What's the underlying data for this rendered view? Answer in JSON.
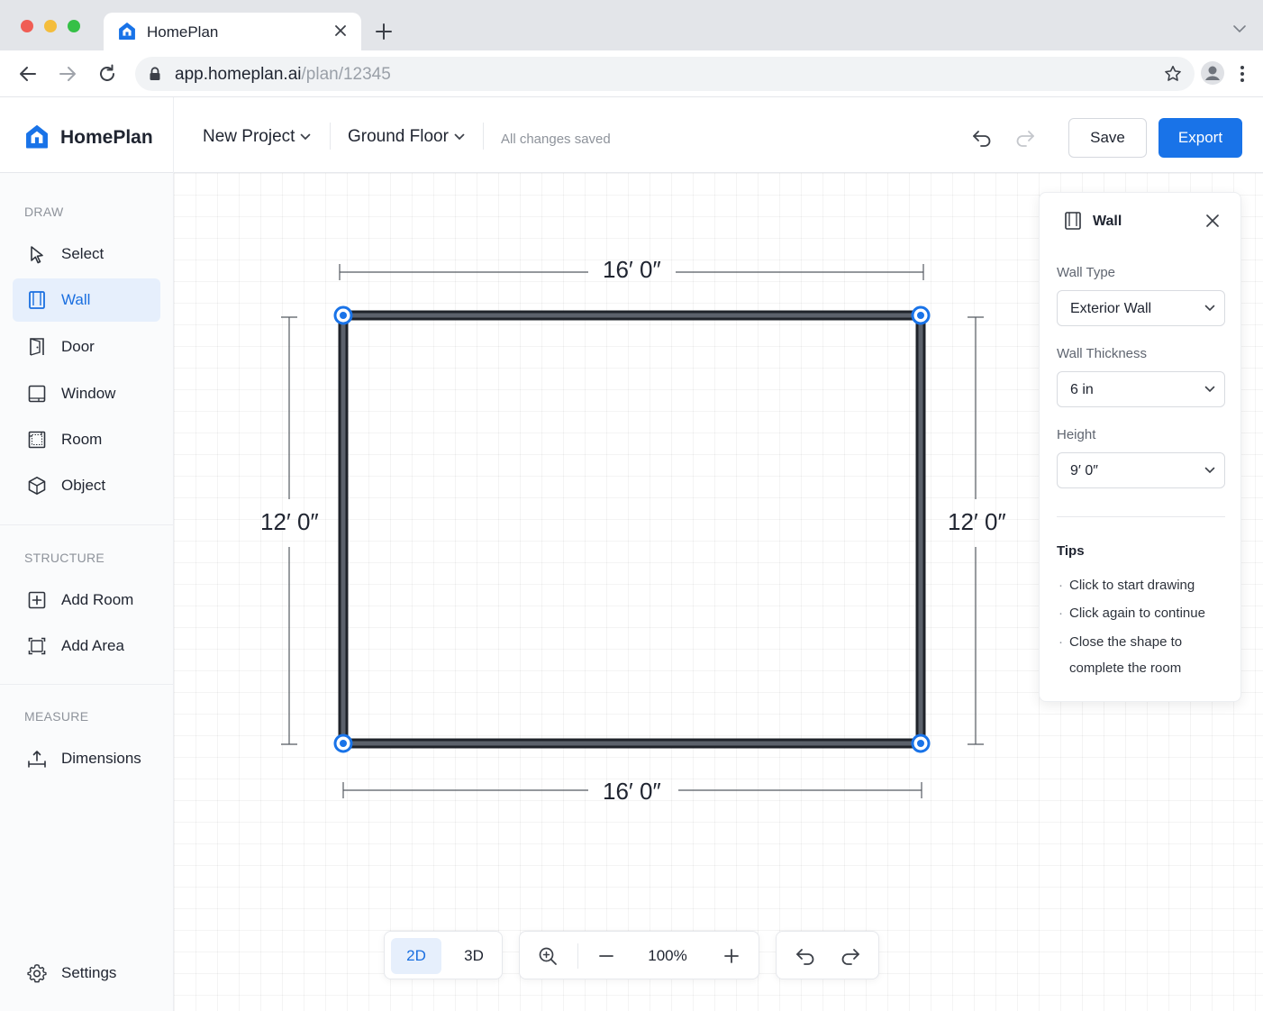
{
  "browser": {
    "tab_title": "HomePlan",
    "url_host": "app.homeplan.ai",
    "url_path": "/plan/12345"
  },
  "header": {
    "brand": "HomePlan",
    "project_label": "New Project",
    "floor_label": "Ground Floor",
    "save_status": "All changes saved",
    "save_label": "Save",
    "export_label": "Export"
  },
  "sidebar": {
    "draw_title": "DRAW",
    "draw_items": [
      {
        "label": "Select",
        "icon": "cursor-icon",
        "active": false
      },
      {
        "label": "Wall",
        "icon": "wall-icon",
        "active": true
      },
      {
        "label": "Door",
        "icon": "door-icon",
        "active": false
      },
      {
        "label": "Window",
        "icon": "window-icon",
        "active": false
      },
      {
        "label": "Room",
        "icon": "room-icon",
        "active": false
      },
      {
        "label": "Object",
        "icon": "cube-icon",
        "active": false
      }
    ],
    "structure_title": "STRUCTURE",
    "structure_items": [
      {
        "label": "Add Room",
        "icon": "add-room-icon"
      },
      {
        "label": "Add Area",
        "icon": "add-area-icon"
      }
    ],
    "measure_title": "MEASURE",
    "measure_items": [
      {
        "label": "Dimensions",
        "icon": "dimensions-icon"
      }
    ],
    "settings_label": "Settings"
  },
  "canvas": {
    "dimensions": {
      "top": "16′ 0″",
      "bottom": "16′ 0″",
      "left": "12′ 0″",
      "right": "12′ 0″"
    }
  },
  "properties": {
    "title": "Wall",
    "wall_type_label": "Wall Type",
    "wall_type_value": "Exterior Wall",
    "thickness_label": "Wall Thickness",
    "thickness_value": "6 in",
    "height_label": "Height",
    "height_value": "9′ 0″",
    "tips_title": "Tips",
    "tips": [
      "Click to start drawing",
      "Click again to continue",
      "Close the shape to",
      "complete the room"
    ]
  },
  "toolbar": {
    "view_2d": "2D",
    "view_3d": "3D",
    "active_view": "2D",
    "zoom": "100%"
  },
  "colors": {
    "accent": "#1973e8",
    "wall": "#2b2f36",
    "active_bg": "#e6effc"
  }
}
